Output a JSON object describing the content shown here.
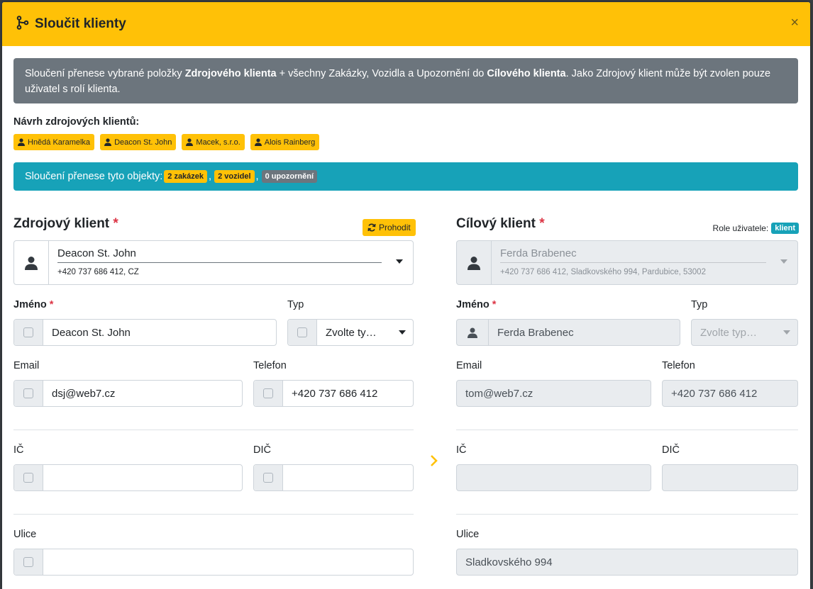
{
  "modal": {
    "title": "Sloučit klienty",
    "close": "×"
  },
  "info_alert": {
    "part1": "Sloučení přenese vybrané položky ",
    "bold1": "Zdrojového klienta",
    "part2": " + všechny Zakázky, Vozidla a Upozornění do ",
    "bold2": "Cílového klienta",
    "part3": ". Jako Zdrojový klient může být zvolen pouze uživatel s rolí klienta."
  },
  "suggestions": {
    "label": "Návrh zdrojových klientů:",
    "items": [
      "Hnědá Karamelka",
      "Deacon St. John",
      "Macek, s.r.o.",
      "Alois Rainberg"
    ]
  },
  "objects_alert": {
    "text": "Sloučení přenese tyto objekty:",
    "orders": "2 zakázek",
    "vehicles": "2 vozidel",
    "warnings": "0 upozornění",
    "sep": ","
  },
  "colors": {
    "header": "#ffc107",
    "secondary": "#6c757d",
    "info": "#17a2b8",
    "required": "#dc3545"
  },
  "source": {
    "title": "Zdrojový klient",
    "required_mark": "*",
    "swap_label": "Prohodit",
    "client_name": "Deacon St. John",
    "client_sub": "+420 737 686 412, CZ",
    "name_label": "Jméno",
    "name_value": "Deacon St. John",
    "type_label": "Typ",
    "type_value": "Zvolte ty…",
    "email_label": "Email",
    "email_value": "dsj@web7.cz",
    "phone_label": "Telefon",
    "phone_value": "+420 737 686 412",
    "ic_label": "IČ",
    "ic_value": "",
    "dic_label": "DIČ",
    "dic_value": "",
    "street_label": "Ulice",
    "street_value": ""
  },
  "target": {
    "title": "Cílový klient",
    "required_mark": "*",
    "role_label": "Role uživatele:",
    "role_value": "klient",
    "client_name": "Ferda Brabenec",
    "client_sub": "+420 737 686 412, Sladkovského 994, Pardubice, 53002",
    "name_label": "Jméno",
    "name_value": "Ferda Brabenec",
    "type_label": "Typ",
    "type_value": "Zvolte typ…",
    "email_label": "Email",
    "email_value": "tom@web7.cz",
    "phone_label": "Telefon",
    "phone_value": "+420 737 686 412",
    "ic_label": "IČ",
    "ic_value": "",
    "dic_label": "DIČ",
    "dic_value": "",
    "street_label": "Ulice",
    "street_value": "Sladkovského 994"
  }
}
